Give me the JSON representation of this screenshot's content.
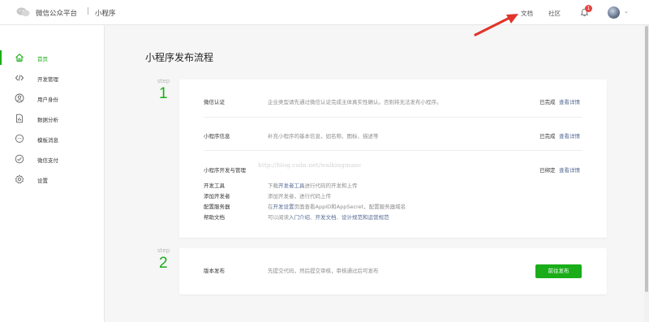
{
  "header": {
    "brand": "微信公众平台",
    "separator": "|",
    "product": "小程序",
    "doc_link": "文档",
    "community_link": "社区",
    "notification_count": "1",
    "avatar_caret": "⌄"
  },
  "sidebar": {
    "items": [
      {
        "label": "首页",
        "icon": "home-icon",
        "active": true
      },
      {
        "label": "开发管理",
        "icon": "code-icon"
      },
      {
        "label": "用户身份",
        "icon": "user-icon"
      },
      {
        "label": "数据分析",
        "icon": "document-chart-icon"
      },
      {
        "label": "模板消息",
        "icon": "message-icon"
      },
      {
        "label": "微信支付",
        "icon": "payment-icon"
      },
      {
        "label": "设置",
        "icon": "gear-icon"
      }
    ]
  },
  "main": {
    "title": "小程序发布流程",
    "step_word": "step",
    "step1": {
      "number": "1",
      "rows": [
        {
          "title": "微信认证",
          "desc": "企业类型请先通过微信认证完成主体真实性确认。否则将无法发布小程序。",
          "status": "已完成",
          "link": "查看详情"
        },
        {
          "title": "小程序信息",
          "desc": "补充小程序的基本信息，如名称、图标、描述等",
          "status": "已完成",
          "link": "查看详情"
        },
        {
          "title": "小程序开发与管理",
          "desc": "",
          "status": "已绑定",
          "link": "查看详情"
        }
      ],
      "dev_items": [
        {
          "title": "开发工具",
          "pre": "下载",
          "link1": "开发者工具",
          "mid": "进行代码的开发和上传"
        },
        {
          "title": "添加开发者",
          "pre": "添加开发者，进行代码上传"
        },
        {
          "title": "配置服务器",
          "pre": "在",
          "link1": "开发设置",
          "mid": "页面查看AppID和AppSecret，配置服务器域名"
        },
        {
          "title": "帮助文档",
          "pre": "可以阅读",
          "link1": "入门介绍",
          "sep1": "、",
          "link2": "开发文档",
          "sep2": "、",
          "link3": "设计规范和运营规范"
        }
      ]
    },
    "step2": {
      "number": "2",
      "title": "版本发布",
      "desc": "先提交代码，然后提交审核，审核通过后可发布",
      "button": "前往发布"
    },
    "watermark": "http://blog.csdn.net/walkingmanc"
  },
  "colors": {
    "accent_green": "#1aad19",
    "link_blue": "#576b95",
    "annotation_red": "#e0352b",
    "badge_red": "#e64340"
  }
}
